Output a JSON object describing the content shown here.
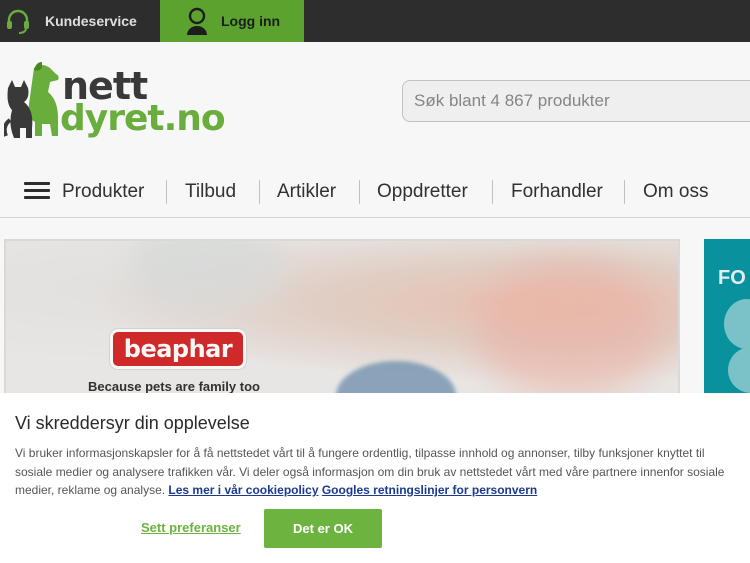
{
  "topbar": {
    "customer_service": "Kundeservice",
    "login": "Logg inn"
  },
  "header": {
    "logo_line1": "nett",
    "logo_line2": "dyret.no",
    "search_placeholder": "Søk blant 4 867 produkter"
  },
  "nav": {
    "items": [
      "Produkter",
      "Tilbud",
      "Artikler",
      "Oppdretter",
      "Forhandler",
      "Om oss"
    ]
  },
  "banner": {
    "brand": "beaphar",
    "tagline": "Because pets are family too",
    "side_text": "FO"
  },
  "cookie": {
    "title": "Vi skreddersyr din opplevelse",
    "body": "Vi bruker informasjonskapsler for å få nettstedet vårt til å fungere ordentlig, tilpasse innhold og annonser, tilby funksjoner knyttet til sosiale medier og analysere trafikken vår. Vi deler også informasjon om din bruk av nettstedet vårt med våre partnere innenfor sosiale medier, reklame og analyse.",
    "link_policy": "Les mer i vår cookiepolicy",
    "link_google": "Googles retningslinjer for personvern",
    "preferences": "Sett preferanser",
    "accept": "Det er OK"
  },
  "colors": {
    "brand_green": "#6db33f",
    "topbar": "#2f2f2f",
    "login_green": "#5fa830"
  },
  "icons": [
    "headset-icon",
    "user-icon",
    "hamburger-menu-icon",
    "pets-logo"
  ]
}
